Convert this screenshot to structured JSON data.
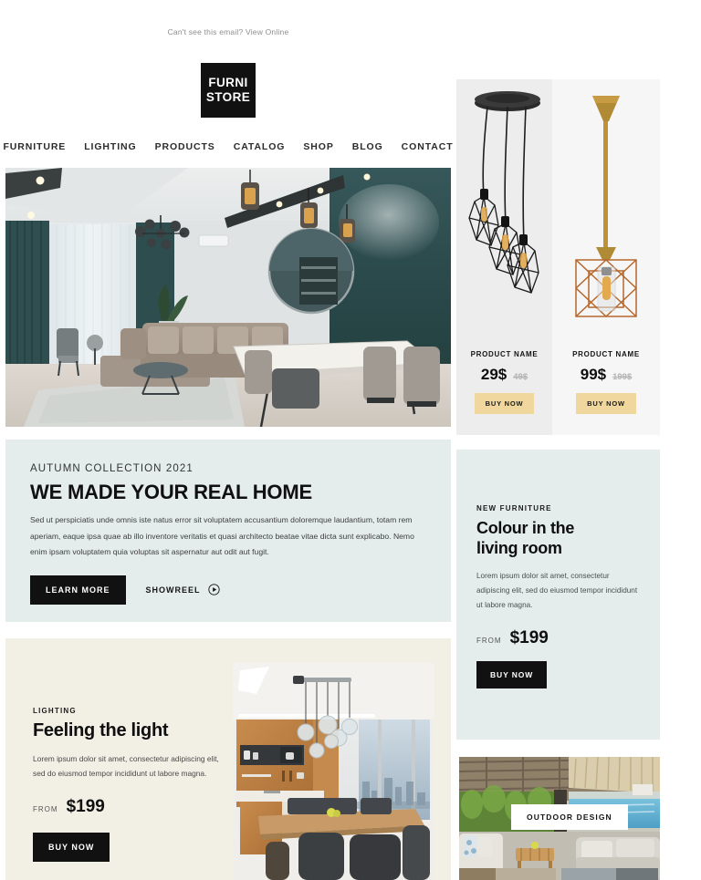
{
  "preheader": {
    "text": "Can't see this email? View Online"
  },
  "brand": {
    "line1": "FURNI",
    "line2": "STORE"
  },
  "nav": {
    "items": [
      {
        "label": "FURNITURE"
      },
      {
        "label": "LIGHTING"
      },
      {
        "label": "PRODUCTS"
      },
      {
        "label": "CATALOG"
      },
      {
        "label": "SHOP"
      },
      {
        "label": "BLOG"
      },
      {
        "label": "CONTACT"
      }
    ]
  },
  "hero": {
    "image_alt": "modern living room with teal accent wall, sectional sofa and dining table"
  },
  "autumn": {
    "eyebrow": "AUTUMN COLLECTION 2021",
    "headline": "WE MADE YOUR REAL HOME",
    "body": "Sed ut perspiciatis unde omnis iste natus error sit voluptatem accusantium doloremque laudantium, totam rem aperiam, eaque ipsa quae ab illo inventore veritatis et quasi architecto beatae vitae dicta sunt explicabo. Nemo enim ipsam voluptatem quia voluptas sit aspernatur aut odit aut fugit.",
    "primary_cta": "LEARN MORE",
    "secondary_cta": "SHOWREEL",
    "play_icon": "play-circle-icon"
  },
  "lighting": {
    "eyebrow": "LIGHTING",
    "headline": "Feeling the light",
    "body": "Lorem ipsum dolor sit amet, consectetur adipiscing elit, sed do eiusmod tempor incididunt ut labore magna.",
    "from_label": "FROM",
    "price": "$199",
    "cta": "BUY NOW",
    "image_alt": "kitchen dining area with cluster glass pendant lights"
  },
  "products": [
    {
      "name": "PRODUCT NAME",
      "price": "29$",
      "old_price": "49$",
      "cta": "BUY NOW",
      "image_alt": "black geometric wire cage pendant cluster"
    },
    {
      "name": "PRODUCT NAME",
      "price": "99$",
      "old_price": "199$",
      "cta": "BUY NOW",
      "image_alt": "copper geometric cage pendant lamp"
    }
  ],
  "colour_block": {
    "eyebrow": "NEW FURNITURE",
    "headline_line1": "Colour in the",
    "headline_line2": "living room",
    "body": "Lorem ipsum dolor sit amet, consectetur adipiscing elit, sed do eiusmod tempor incididunt ut labore magna.",
    "from_label": "FROM",
    "price": "$199",
    "cta": "BUY NOW"
  },
  "outdoor": {
    "badge": "OUTDOOR DESIGN",
    "image_alt": "outdoor patio lounge with pool and thatched roof"
  },
  "colors": {
    "dark": "#111111",
    "pale_blue": "#e4ecec",
    "cream": "#f2efe5",
    "gold": "#efd79e",
    "teal_wall": "#2d4f50"
  }
}
